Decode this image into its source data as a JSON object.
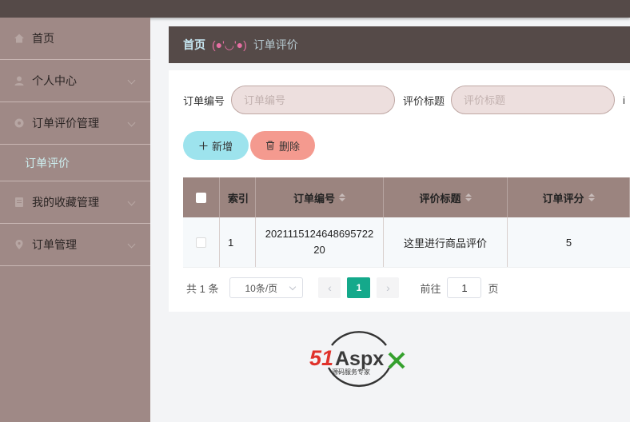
{
  "sidebar": {
    "items": [
      {
        "label": "首页",
        "icon": "home-icon"
      },
      {
        "label": "个人中心",
        "icon": "user-icon"
      },
      {
        "label": "订单评价管理",
        "icon": "settings-icon",
        "sub": [
          {
            "label": "订单评价"
          }
        ]
      },
      {
        "label": "我的收藏管理",
        "icon": "document-icon"
      },
      {
        "label": "订单管理",
        "icon": "location-icon"
      }
    ]
  },
  "breadcrumb": {
    "home": "首页",
    "face": "(●'◡'●)",
    "current": "订单评价"
  },
  "search": {
    "order_no_label": "订单编号",
    "order_no_placeholder": "订单编号",
    "title_label": "评价标题",
    "title_placeholder": "评价标题",
    "truncated_label": "i"
  },
  "actions": {
    "add_label": "新增",
    "delete_label": "删除"
  },
  "table": {
    "columns": [
      "索引",
      "订单编号",
      "评价标题",
      "订单评分"
    ],
    "rows": [
      {
        "index": "1",
        "order_no": "202111512464869572220",
        "title": "这里进行商品评价",
        "score": "5"
      }
    ]
  },
  "pagination": {
    "total": "共 1 条",
    "page_size": "10条/页",
    "current_page": "1",
    "goto_prefix": "前往",
    "goto_value": "1",
    "goto_suffix": "页"
  },
  "logo": {
    "brand": "51Aspx",
    "tagline": "源码服务专家"
  },
  "colors": {
    "accent": "#14a98b",
    "sidebar": "#9f8986",
    "header": "#554a48",
    "add_button": "#9de3ed",
    "delete_button": "#f49a8f"
  }
}
